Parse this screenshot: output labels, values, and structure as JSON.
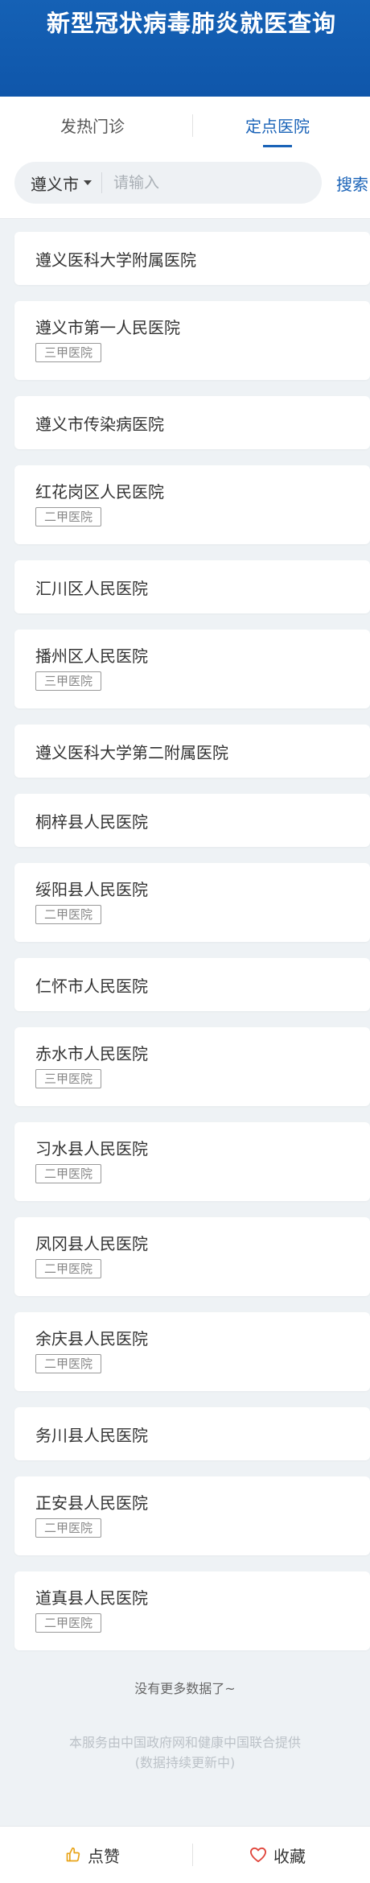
{
  "header": {
    "title": "新型冠状病毒肺炎就医查询"
  },
  "tabs": [
    {
      "label": "发热门诊"
    },
    {
      "label": "定点医院"
    }
  ],
  "search": {
    "city": "遵义市",
    "placeholder": "请输入",
    "button": "搜索"
  },
  "hospitals": [
    {
      "name": "遵义医科大学附属医院",
      "level": ""
    },
    {
      "name": "遵义市第一人民医院",
      "level": "三甲医院"
    },
    {
      "name": "遵义市传染病医院",
      "level": ""
    },
    {
      "name": "红花岗区人民医院",
      "level": "二甲医院"
    },
    {
      "name": "汇川区人民医院",
      "level": ""
    },
    {
      "name": "播州区人民医院",
      "level": "三甲医院"
    },
    {
      "name": "遵义医科大学第二附属医院",
      "level": ""
    },
    {
      "name": "桐梓县人民医院",
      "level": ""
    },
    {
      "name": "绥阳县人民医院",
      "level": "二甲医院"
    },
    {
      "name": "仁怀市人民医院",
      "level": ""
    },
    {
      "name": "赤水市人民医院",
      "level": "三甲医院"
    },
    {
      "name": "习水县人民医院",
      "level": "二甲医院"
    },
    {
      "name": "凤冈县人民医院",
      "level": "二甲医院"
    },
    {
      "name": "余庆县人民医院",
      "level": "二甲医院"
    },
    {
      "name": "务川县人民医院",
      "level": ""
    },
    {
      "name": "正安县人民医院",
      "level": "二甲医院"
    },
    {
      "name": "道真县人民医院",
      "level": "二甲医院"
    }
  ],
  "list_end": "没有更多数据了~",
  "footer": {
    "line1": "本服务由中国政府网和健康中国联合提供",
    "line2": "(数据持续更新中)"
  },
  "bottom_bar": {
    "like": "点赞",
    "favorite": "收藏",
    "like_color": "#e8a317",
    "favorite_color": "#e0443a",
    "like_icon": "thumbs-up-icon",
    "favorite_icon": "heart-icon"
  },
  "colors": {
    "brand": "#1561b5",
    "accent": "#1a63b8"
  }
}
